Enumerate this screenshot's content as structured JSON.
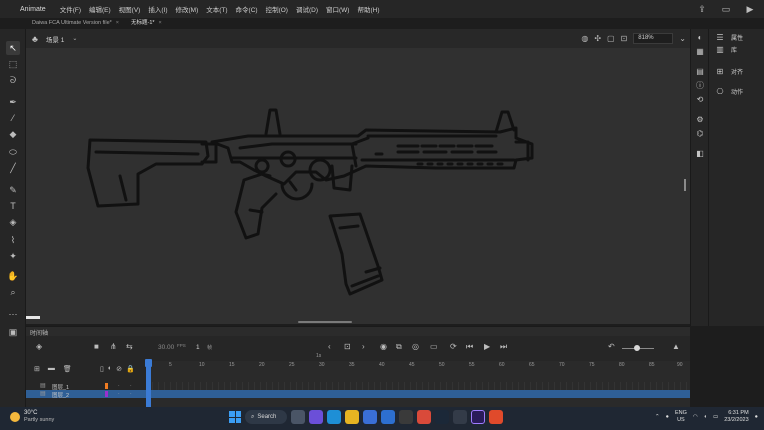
{
  "app": {
    "title": "Animate"
  },
  "menu": [
    "文件(F)",
    "编辑(E)",
    "视图(V)",
    "插入(I)",
    "修改(M)",
    "文本(T)",
    "命令(C)",
    "控制(O)",
    "调试(D)",
    "窗口(W)",
    "帮助(H)"
  ],
  "tabs": [
    {
      "label": "Daiwa FCA Ultimate Version file*"
    },
    {
      "label": "无标题-1*"
    }
  ],
  "stage_header": {
    "scene_name": "场景 1",
    "zoom": "818%"
  },
  "right_panel": {
    "items": [
      {
        "icon": "properties-icon",
        "label": "属性"
      },
      {
        "icon": "library-icon",
        "label": "库"
      },
      {
        "icon": "align-icon",
        "label": "对齐"
      },
      {
        "icon": "transform-icon",
        "label": "动作"
      }
    ]
  },
  "timeline": {
    "title": "时间轴",
    "fps": "30.00",
    "fps_unit": "FPS",
    "frame": "1",
    "frame_unit": "帧",
    "ruler_labels": [
      "1s",
      "5",
      "10",
      "15",
      "20",
      "25",
      "30",
      "35",
      "40",
      "45",
      "50",
      "55",
      "60",
      "65",
      "70",
      "75",
      "80",
      "85",
      "90"
    ],
    "layers": [
      {
        "name": "图层_1",
        "color": "#f07c22",
        "selected": false
      },
      {
        "name": "图层_2",
        "color": "#9b2fce",
        "selected": true
      }
    ]
  },
  "taskbar": {
    "weather_temp": "30°C",
    "weather_cond": "Partly sunny",
    "search_label": "Search",
    "lang_line1": "ENG",
    "lang_line2": "US",
    "time": "6:31 PM",
    "date": "23/2/2023"
  }
}
